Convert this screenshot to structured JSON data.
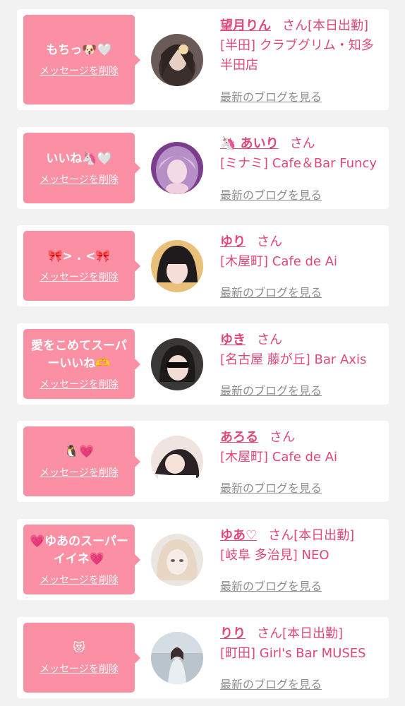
{
  "colors": {
    "background": "#f2f2f2",
    "card": "#ffffff",
    "bubble": "#fb8fa4",
    "accent_pink": "#e04878",
    "link_gray": "#8d8d8d"
  },
  "delete_label": "メッセージを削除",
  "blog_label": "最新のブログを見る",
  "san_label": "さん",
  "entries": [
    {
      "message": "もちっ🐶🤍",
      "name": "望月りん",
      "status": "[本日出勤]",
      "shop": "[半田] クラブグリム・知多半田店",
      "avatar_icon": "avatar-photo-woman"
    },
    {
      "message": "いいね🦄🤍",
      "name": "🦄 あいり",
      "status": "",
      "shop": "[ミナミ] Cafe＆Bar Funcy",
      "avatar_icon": "avatar-photo-woman"
    },
    {
      "message": "🎀> . <🎀",
      "name": "ゆり",
      "status": "",
      "shop": "[木屋町] Cafe de Ai",
      "avatar_icon": "avatar-photo-woman"
    },
    {
      "message": "愛をこめてスーパーいいね🫶",
      "name": "ゆき",
      "status": "",
      "shop": "[名古屋 藤が丘] Bar Axis",
      "avatar_icon": "avatar-photo-woman"
    },
    {
      "message": "🐧💗",
      "name": "あろる",
      "status": "",
      "shop": "[木屋町] Cafe de Ai",
      "avatar_icon": "avatar-photo-woman"
    },
    {
      "message": "💗ゆあのスーパーイイネ💗",
      "name": "ゆあ♡",
      "status": "[本日出勤]",
      "shop": "[岐阜 多治見] NEO",
      "avatar_icon": "avatar-photo-woman"
    },
    {
      "message": "😻",
      "name": "りり",
      "status": "[本日出勤]",
      "shop": "[町田] Girl's Bar MUSES",
      "avatar_icon": "avatar-photo-woman"
    }
  ]
}
